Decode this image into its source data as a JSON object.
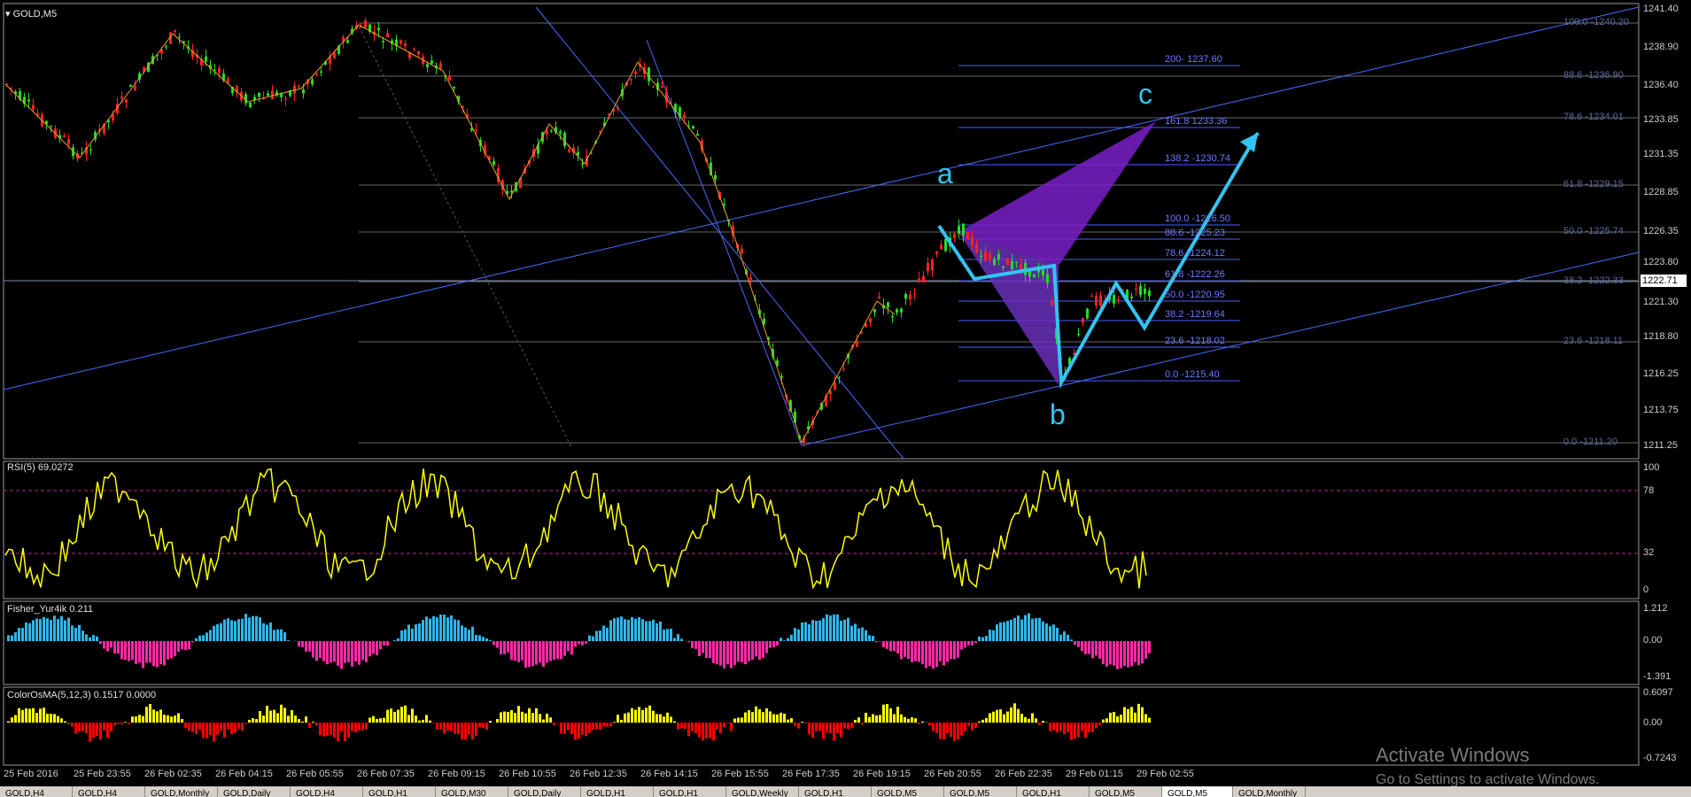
{
  "symbol": "GOLD,M5",
  "current_price": "1222.71",
  "price_axis": [
    "1241.40",
    "1238.90",
    "1236.40",
    "1233.85",
    "1231.35",
    "1228.85",
    "1226.35",
    "1223.80",
    "1221.30",
    "1218.80",
    "1216.25",
    "1213.75",
    "1211.25"
  ],
  "fib_right": [
    "100.0 -1240.20",
    "88.6 -1236.90",
    "78.6 -1234.01",
    "61.8 -1229.15",
    "50.0 -1225.74",
    "38.2 -1222.33",
    "23.6 -1218.11",
    "0.0 -1211.20"
  ],
  "fib_mid": [
    "200- 1237.60",
    "161.8 1233.36",
    "138.2 -1230.74",
    "100.0 -1226.50",
    "88.6 -1225.23",
    "78.6 -1224.12",
    "61.8 -1222.26",
    "50.0 -1220.95",
    "38.2 -1219.64",
    "23.6 -1218.02",
    "0.0 -1215.40"
  ],
  "waves": [
    "a",
    "b",
    "c"
  ],
  "rsi": {
    "title": "RSI(5) 69.0272",
    "axis": [
      "100",
      "78",
      "32",
      "0"
    ]
  },
  "fisher": {
    "title": "Fisher_Yur4ik 0.211",
    "axis": [
      "1.212",
      "0.00",
      "-1.391"
    ]
  },
  "osma": {
    "title": "ColorOsMA(5,12,3) 0.1517 0.0000",
    "axis": [
      "0.6097",
      "0.00",
      "-0.7243"
    ]
  },
  "time_axis": [
    "25 Feb 2016",
    "25 Feb 23:55",
    "26 Feb 02:35",
    "26 Feb 04:15",
    "26 Feb 05:55",
    "26 Feb 07:35",
    "26 Feb 09:15",
    "26 Feb 10:55",
    "26 Feb 12:35",
    "26 Feb 14:15",
    "26 Feb 15:55",
    "26 Feb 17:35",
    "26 Feb 19:15",
    "26 Feb 20:55",
    "26 Feb 22:35",
    "29 Feb 01:15",
    "29 Feb 02:55"
  ],
  "tabs": [
    "GOLD,H4",
    "GOLD,H4",
    "GOLD,Monthly",
    "GOLD,Daily",
    "GOLD,H4",
    "GOLD,H1",
    "GOLD,M30",
    "GOLD,Daily",
    "GOLD,H1",
    "GOLD,H1",
    "GOLD,Weekly",
    "GOLD,H1",
    "GOLD,M5",
    "GOLD,M5",
    "GOLD,H1",
    "GOLD,M5",
    "GOLD,M5",
    "GOLD,Monthly"
  ],
  "active_tab_index": 16,
  "watermark": {
    "line1": "Activate Windows",
    "line2": "Go to Settings to activate Windows."
  },
  "colors": {
    "bull": "#22dd22",
    "bear": "#ff2222",
    "wave": "#33c4f3",
    "fib": "#4a5cff",
    "rsi": "#ffff00",
    "hist_pos": "#2fb6e8",
    "hist_neg": "#ff2aa8",
    "osma_pos": "#ffff00",
    "osma_neg": "#ff0000",
    "pattern": "#7a1fc8"
  }
}
